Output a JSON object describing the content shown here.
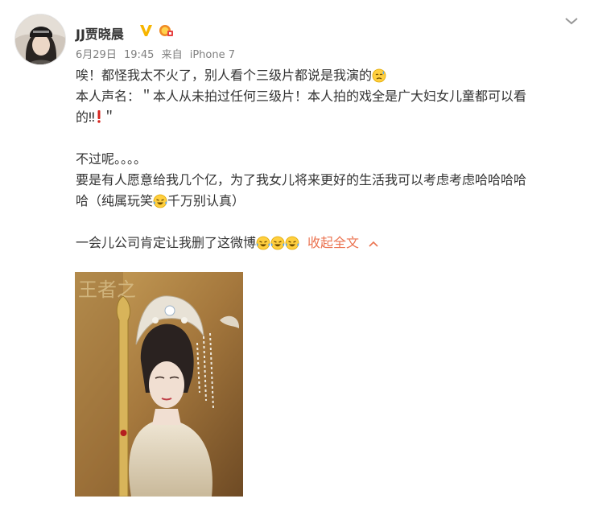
{
  "user": {
    "name": "JJ贾晓晨",
    "avatar_icon": "avatar-photo",
    "verified_icon": "verified-v-icon",
    "medal_icon": "medal-badge-icon"
  },
  "post": {
    "date": "6月29日",
    "time": "19:45",
    "source_prefix": "来自",
    "source": "iPhone 7",
    "lines": {
      "l1": "唉！都怪我太不火了，别人看个三级片都说是我演的",
      "l2": "本人声名：＂本人从未拍过任何三级片！本人拍的戏全是广大妇女儿童都可以看",
      "l3a": "的‼",
      "l3b": "＂",
      "l4": "不过呢。。。。",
      "l5": "要是有人愿意给我几个亿，为了我女儿将来更好的生活我可以考虑考虑哈哈哈哈",
      "l6a": "哈（纯属玩笑",
      "l6b": "千万别认真）",
      "l7": "一会儿公司肯定让我删了这微博"
    },
    "collapse_label": "收起全文",
    "image_icon": "costume-portrait-photo"
  },
  "colors": {
    "text": "#333333",
    "meta": "#808080",
    "link": "#eb7350",
    "verified": "#f7b500"
  }
}
